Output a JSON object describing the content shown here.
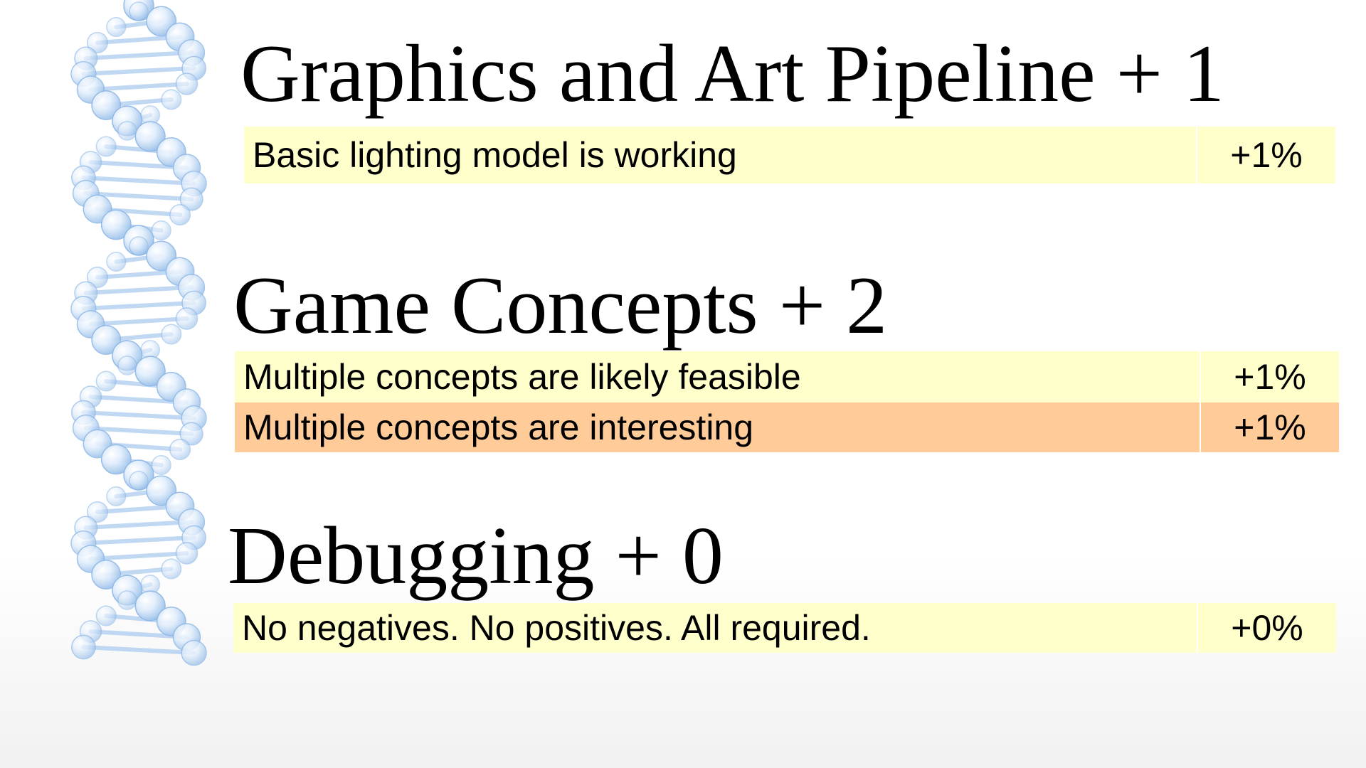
{
  "sections": [
    {
      "heading": "Graphics and Art Pipeline + 1",
      "rows": [
        {
          "label": "Basic lighting model is working",
          "value": "+1%"
        }
      ]
    },
    {
      "heading": "Game Concepts + 2",
      "rows": [
        {
          "label": "Multiple concepts are likely feasible",
          "value": "+1%"
        },
        {
          "label": "Multiple concepts are interesting",
          "value": "+1%"
        }
      ]
    },
    {
      "heading": "Debugging + 0",
      "rows": [
        {
          "label": "No negatives. No positives. All required.",
          "value": "+0%"
        }
      ]
    }
  ],
  "colors": {
    "row_yellow": "#ffffcc",
    "row_orange": "#ffcc99",
    "helix": "#aaccf0"
  },
  "decoration": {
    "icon": "dna-helix-icon"
  }
}
